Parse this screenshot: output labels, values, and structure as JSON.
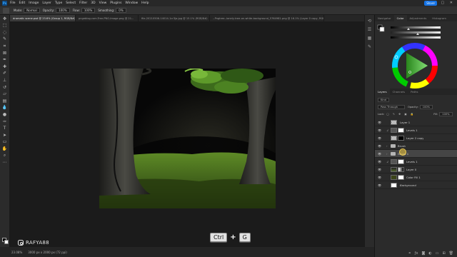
{
  "menubar": {
    "logo": "Ps",
    "items": [
      "File",
      "Edit",
      "Image",
      "Layer",
      "Type",
      "Select",
      "Filter",
      "3D",
      "View",
      "Plugins",
      "Window",
      "Help"
    ],
    "share": "Share"
  },
  "options": {
    "mode_label": "Mode:",
    "mode_value": "Normal",
    "opacity_label": "Opacity:",
    "opacity_value": "100%",
    "flow_label": "Flow:",
    "flow_value": "100%",
    "smoothing_label": "Smoothing:",
    "smoothing_value": "0%"
  },
  "tabs": [
    {
      "label": "dramatic scene.psd @ 23.6% (Group 1, RGB/8#) *",
      "active": true
    },
    {
      "label": "pngeblog.com-Tree-PNG-Image.png @ 21...",
      "active": false
    },
    {
      "label": "file-20210506-14014-1cr3ja.jpg @ 15.1% (RGB/8#)",
      "active": false
    },
    {
      "label": "--Pngtree--lonely-tree-on-white-background_5764981.png @ 16.1% (Layer 0 copy, RGB/8#)",
      "active": false
    }
  ],
  "status": {
    "zoom": "23.08%",
    "doc_info": "3000 px x 2000 px (72 ppi)"
  },
  "watermark": "RAFYA88",
  "shortcut": {
    "key1": "Ctrl",
    "plus": "+",
    "key2": "G"
  },
  "panels": {
    "top_tabs": [
      "Navigator",
      "Color",
      "Adjustments",
      "Histogram"
    ],
    "layers_tabs": [
      "Layers",
      "Channels",
      "Paths"
    ],
    "filter_kind": "Kind",
    "blend_mode": "Pass Through",
    "opacity_label": "Opacity:",
    "opacity_value": "100%",
    "lock_label": "Lock:",
    "fill_label": "Fill:",
    "fill_value": "100%"
  },
  "layers": [
    {
      "name": "Layer 1",
      "type": "pixel",
      "selected": false
    },
    {
      "name": "Levels 1",
      "type": "adjustment",
      "selected": false
    },
    {
      "name": "Layer 2 copy",
      "type": "pixel-mask",
      "selected": false
    },
    {
      "name": "Brush",
      "type": "group",
      "selected": false
    },
    {
      "name": "Group 1",
      "type": "group",
      "selected": true
    },
    {
      "name": "Levels 1",
      "type": "adjustment",
      "selected": false
    },
    {
      "name": "Layer 0",
      "type": "pixel-mask",
      "selected": false
    },
    {
      "name": "Color Fill 1",
      "type": "fill",
      "selected": false
    },
    {
      "name": "Background",
      "type": "background",
      "selected": false
    }
  ],
  "colors": {
    "accent": "#1473e6",
    "panel_bg": "#2b2b2b",
    "canvas_bg": "#1b1b1b"
  }
}
